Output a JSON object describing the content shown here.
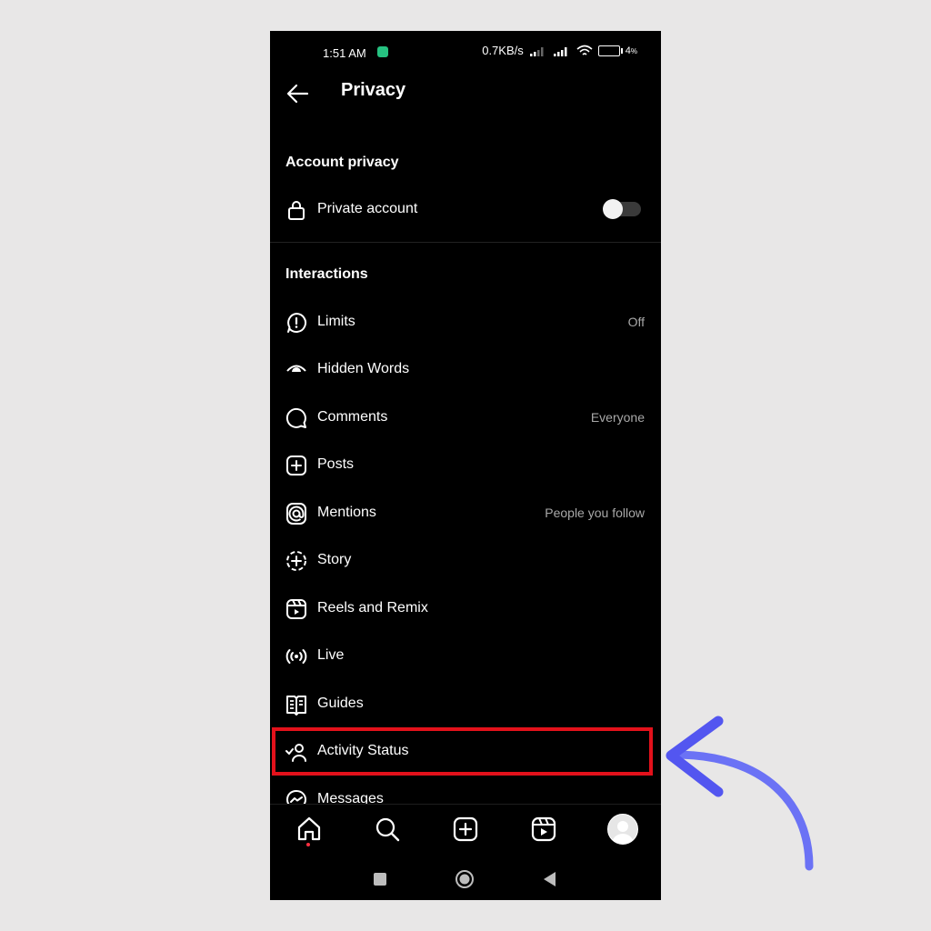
{
  "status_bar": {
    "time": "1:51 AM",
    "network_speed": "0.7KB/s",
    "battery_percent": "4",
    "battery_unit": "%"
  },
  "header": {
    "title": "Privacy"
  },
  "account_privacy": {
    "section_title": "Account privacy",
    "private_account": {
      "label": "Private account",
      "enabled": false
    }
  },
  "interactions": {
    "section_title": "Interactions",
    "items": [
      {
        "label": "Limits",
        "value": "Off",
        "icon": "limits-icon"
      },
      {
        "label": "Hidden Words",
        "value": "",
        "icon": "hidden-words-icon"
      },
      {
        "label": "Comments",
        "value": "Everyone",
        "icon": "comment-icon"
      },
      {
        "label": "Posts",
        "value": "",
        "icon": "add-post-icon"
      },
      {
        "label": "Mentions",
        "value": "People you follow",
        "icon": "mention-icon"
      },
      {
        "label": "Story",
        "value": "",
        "icon": "story-icon"
      },
      {
        "label": "Reels and Remix",
        "value": "",
        "icon": "reels-icon"
      },
      {
        "label": "Live",
        "value": "",
        "icon": "live-icon"
      },
      {
        "label": "Guides",
        "value": "",
        "icon": "guides-icon"
      },
      {
        "label": "Activity Status",
        "value": "",
        "icon": "activity-status-icon"
      },
      {
        "label": "Messages",
        "value": "",
        "icon": "messenger-icon"
      }
    ]
  },
  "colors": {
    "background": "#e8e7e7",
    "screen": "#000000",
    "highlight_border": "#e3111b",
    "arrow": "#6b72f5",
    "notification_dot": "#ff3040"
  }
}
